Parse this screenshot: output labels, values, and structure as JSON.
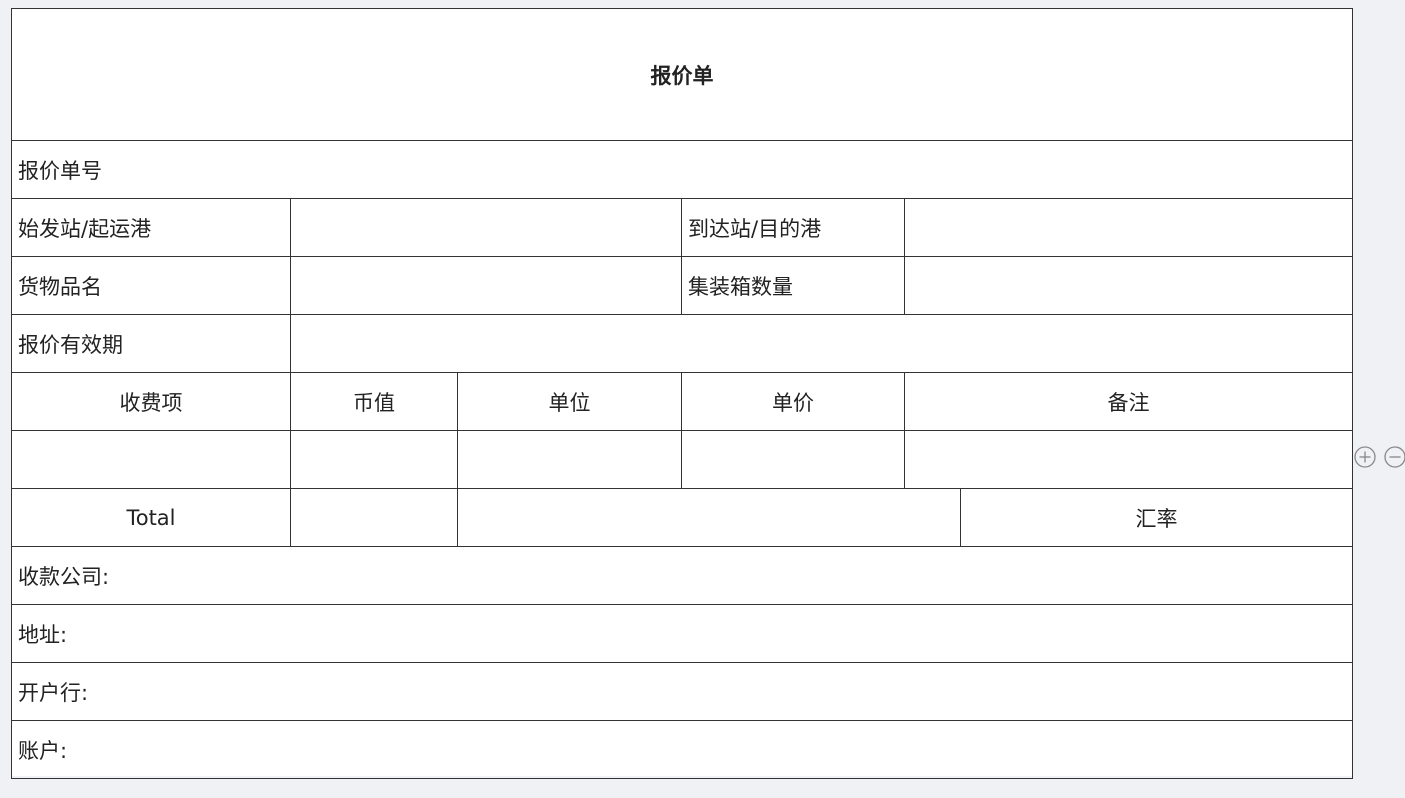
{
  "document": {
    "title": "报价单",
    "quote_no_label": "报价单号",
    "origin_label": "始发站/起运港",
    "destination_label": "到达站/目的港",
    "cargo_name_label": "货物品名",
    "container_qty_label": "集装箱数量",
    "validity_label": "报价有效期",
    "fee_table": {
      "headers": [
        "收费项",
        "币值",
        "单位",
        "单价",
        "备注"
      ]
    },
    "total_label": "Total",
    "exchange_rate_label": "汇率",
    "payee_company_label": "收款公司:",
    "address_label": "地址:",
    "bank_label": "开户行:",
    "account_label": "账户:"
  },
  "row_tools": {
    "add_icon": "plus-circle-icon",
    "remove_icon": "minus-circle-icon"
  }
}
